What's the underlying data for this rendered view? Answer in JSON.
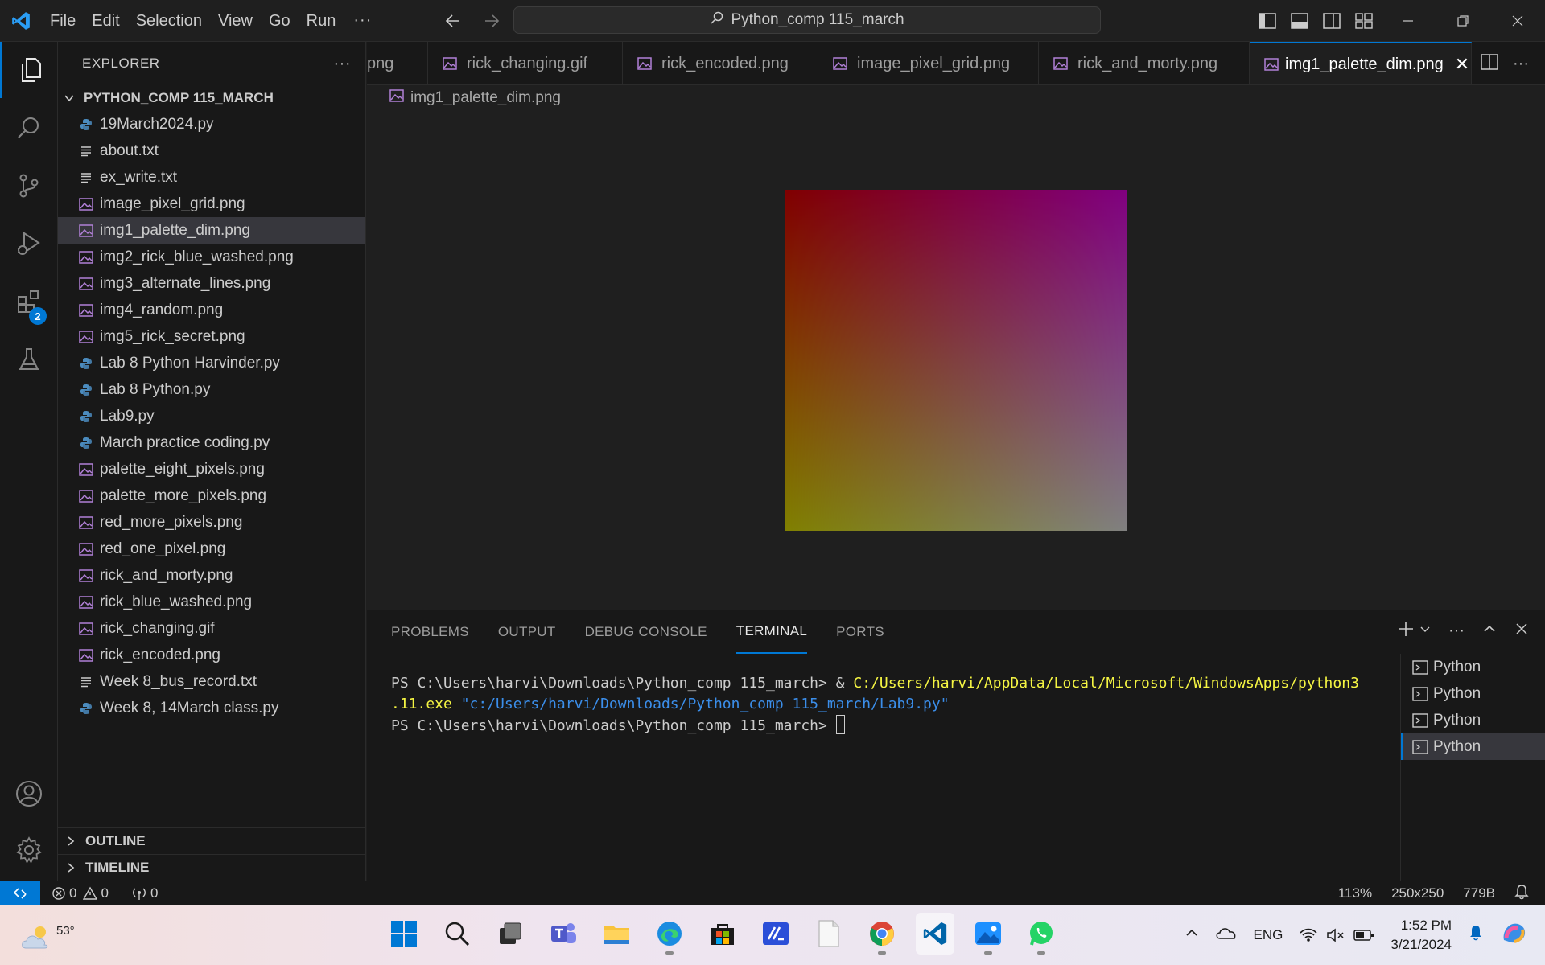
{
  "window": {
    "menu": [
      "File",
      "Edit",
      "Selection",
      "View",
      "Go",
      "Run"
    ],
    "more": "···",
    "search_text": "Python_comp 115_march"
  },
  "sidebar": {
    "title": "EXPLORER",
    "more": "···",
    "folder": "PYTHON_COMP 115_MARCH",
    "files": [
      {
        "name": "19March2024.py",
        "type": "py"
      },
      {
        "name": "about.txt",
        "type": "txt"
      },
      {
        "name": "ex_write.txt",
        "type": "txt"
      },
      {
        "name": "image_pixel_grid.png",
        "type": "png"
      },
      {
        "name": "img1_palette_dim.png",
        "type": "png",
        "selected": true
      },
      {
        "name": "img2_rick_blue_washed.png",
        "type": "png"
      },
      {
        "name": "img3_alternate_lines.png",
        "type": "png"
      },
      {
        "name": "img4_random.png",
        "type": "png"
      },
      {
        "name": "img5_rick_secret.png",
        "type": "png"
      },
      {
        "name": "Lab 8 Python Harvinder.py",
        "type": "py"
      },
      {
        "name": "Lab 8 Python.py",
        "type": "py"
      },
      {
        "name": "Lab9.py",
        "type": "py"
      },
      {
        "name": "March practice coding.py",
        "type": "py"
      },
      {
        "name": "palette_eight_pixels.png",
        "type": "png"
      },
      {
        "name": "palette_more_pixels.png",
        "type": "png"
      },
      {
        "name": "red_more_pixels.png",
        "type": "png"
      },
      {
        "name": "red_one_pixel.png",
        "type": "png"
      },
      {
        "name": "rick_and_morty.png",
        "type": "png"
      },
      {
        "name": "rick_blue_washed.png",
        "type": "png"
      },
      {
        "name": "rick_changing.gif",
        "type": "png"
      },
      {
        "name": "rick_encoded.png",
        "type": "png"
      },
      {
        "name": "Week 8_bus_record.txt",
        "type": "txt"
      },
      {
        "name": "Week 8, 14March class.py",
        "type": "py"
      }
    ],
    "outline": "OUTLINE",
    "timeline": "TIMELINE"
  },
  "activity_badge": "2",
  "tabs": [
    {
      "label": "png",
      "active": false
    },
    {
      "label": "rick_changing.gif",
      "active": false
    },
    {
      "label": "rick_encoded.png",
      "active": false
    },
    {
      "label": "image_pixel_grid.png",
      "active": false
    },
    {
      "label": "rick_and_morty.png",
      "active": false
    },
    {
      "label": "img1_palette_dim.png",
      "active": true
    }
  ],
  "tab_close": "✕",
  "breadcrumb": "img1_palette_dim.png",
  "image_colors": {
    "top_left": "#800000",
    "top_right": "#800080",
    "bottom_left": "#808000",
    "bottom_right": "#808080"
  },
  "panel": {
    "tabs": [
      "PROBLEMS",
      "OUTPUT",
      "DEBUG CONSOLE",
      "TERMINAL",
      "PORTS"
    ],
    "active_tab": "TERMINAL",
    "terminal": {
      "prompt1": "PS C:\\Users\\harvi\\Downloads\\Python_comp 115_march> & ",
      "exe_path_a": "C:/Users/harvi/AppData/Local/Microsoft/WindowsApps/python3",
      "exe_path_b": ".11.exe",
      "script_arg": " \"c:/Users/harvi/Downloads/Python_comp 115_march/Lab9.py\"",
      "prompt2": "PS C:\\Users\\harvi\\Downloads\\Python_comp 115_march> "
    },
    "terminals": [
      "Python",
      "Python",
      "Python",
      "Python"
    ]
  },
  "statusbar": {
    "errors": "0",
    "warnings": "0",
    "ports": "0",
    "zoom": "113%",
    "dimensions": "250x250",
    "size": "779B"
  },
  "taskbar": {
    "temperature": "53°",
    "language": "ENG",
    "time": "1:52 PM",
    "date": "3/21/2024"
  }
}
